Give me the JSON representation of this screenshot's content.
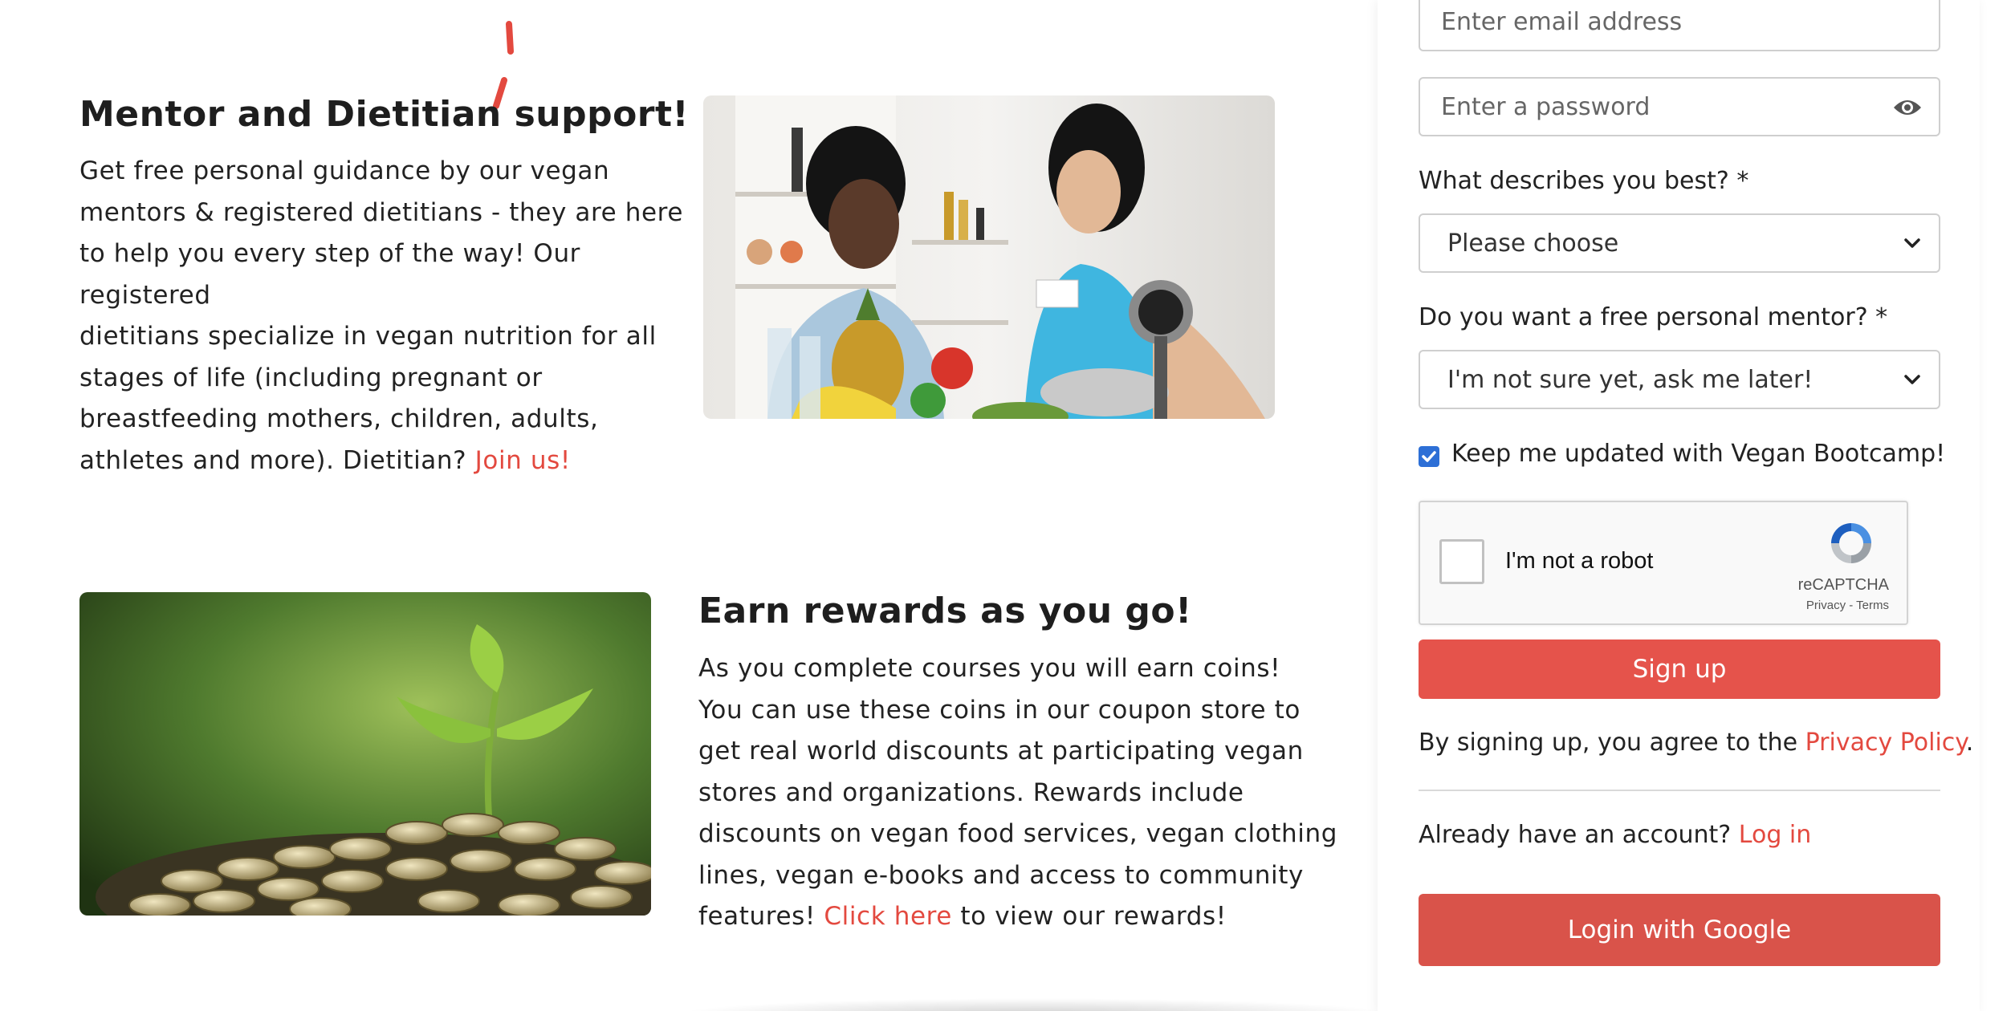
{
  "features": {
    "mentor": {
      "title": "Mentor and Dietitian support!",
      "text_lines": [
        "Get free personal guidance by our vegan",
        "mentors & registered dietitians - they are here",
        "to help you every step of the way! Our registered",
        "dietitians specialize in vegan nutrition for all",
        "stages of life (including pregnant or",
        "breastfeeding mothers, children, adults,",
        "athletes and more). Dietitian?"
      ],
      "link_label": "Join us!"
    },
    "rewards": {
      "title": "Earn rewards as you go!",
      "text_lines": [
        "As you complete courses you will earn coins!",
        "You can use these coins in our coupon store to",
        "get real world discounts at participating vegan",
        "stores and organizations. Rewards include",
        "discounts on vegan food services, vegan clothing",
        "lines, vegan e-books and access to community",
        "features!"
      ],
      "link_label": "Click here",
      "after_link": "to view our rewards!"
    }
  },
  "signup_form": {
    "email_placeholder": "Enter email address",
    "password_placeholder": "Enter a password",
    "describe_label": "What describes you best? *",
    "describe_value": "Please choose",
    "mentor_label": "Do you want a free personal mentor? *",
    "mentor_value": "I'm not sure yet, ask me later!",
    "keep_updated_label": "Keep me updated with Vegan Bootcamp!",
    "keep_updated_checked": true,
    "recaptcha": {
      "label": "I'm not a robot",
      "brand": "reCAPTCHA",
      "terms": "Privacy - Terms"
    },
    "signup_button": "Sign up",
    "agree_prefix": "By signing up, you agree to the",
    "privacy_link": "Privacy Policy",
    "agree_suffix": ".",
    "already_prefix": "Already have an account?",
    "login_link": "Log in",
    "google_button": "Login with Google"
  },
  "colors": {
    "accent": "#e3493f",
    "button": "#e5534b",
    "google_button": "#d9534a",
    "checkbox": "#2d6fd6"
  }
}
